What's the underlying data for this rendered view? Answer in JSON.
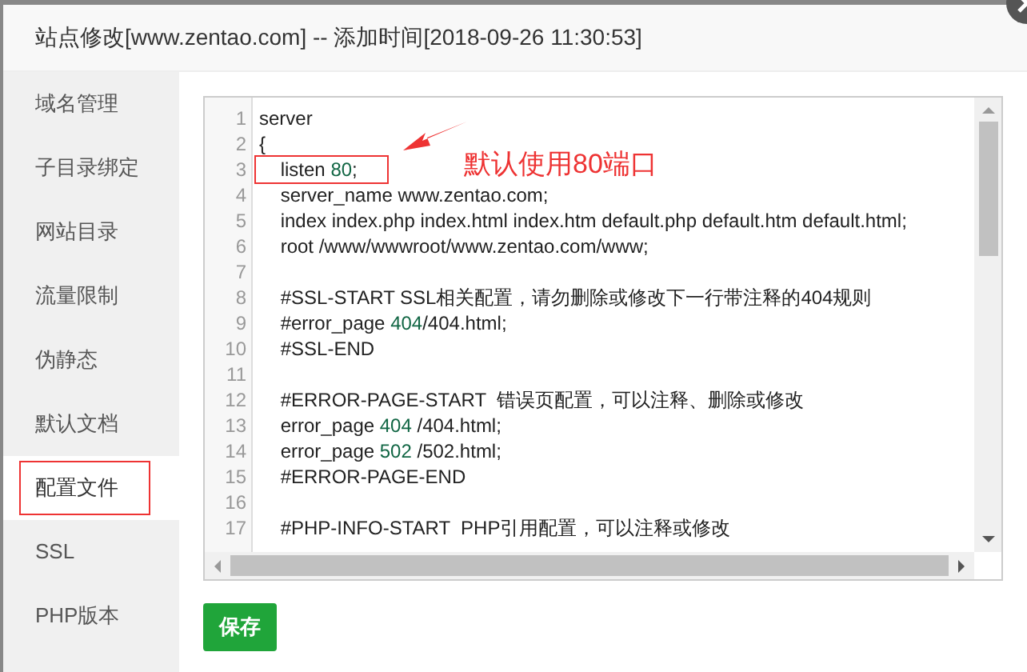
{
  "window": {
    "title": "站点修改[www.zentao.com] -- 添加时间[2018-09-26 11:30:53]"
  },
  "sidebar": {
    "items": [
      {
        "label": "域名管理",
        "selected": false
      },
      {
        "label": "子目录绑定",
        "selected": false
      },
      {
        "label": "网站目录",
        "selected": false
      },
      {
        "label": "流量限制",
        "selected": false
      },
      {
        "label": "伪静态",
        "selected": false
      },
      {
        "label": "默认文档",
        "selected": false
      },
      {
        "label": "配置文件",
        "selected": true
      },
      {
        "label": "SSL",
        "selected": false
      },
      {
        "label": "PHP版本",
        "selected": false
      }
    ]
  },
  "editor": {
    "lines": [
      {
        "number": "1",
        "boxed": false,
        "segments": [
          {
            "kind": "plain",
            "text": "server"
          }
        ]
      },
      {
        "number": "2",
        "boxed": false,
        "segments": [
          {
            "kind": "plain",
            "text": "{"
          }
        ]
      },
      {
        "number": "3",
        "boxed": true,
        "segments": [
          {
            "kind": "plain",
            "text": "    listen "
          },
          {
            "kind": "number",
            "text": "80"
          },
          {
            "kind": "plain",
            "text": ";"
          }
        ]
      },
      {
        "number": "4",
        "boxed": false,
        "segments": [
          {
            "kind": "plain",
            "text": "    server_name www.zentao.com;"
          }
        ]
      },
      {
        "number": "5",
        "boxed": false,
        "segments": [
          {
            "kind": "plain",
            "text": "    index index.php index.html index.htm default.php default.htm default.html;"
          }
        ]
      },
      {
        "number": "6",
        "boxed": false,
        "segments": [
          {
            "kind": "plain",
            "text": "    root /www/wwwroot/www.zentao.com/www;"
          }
        ]
      },
      {
        "number": "7",
        "boxed": false
      },
      {
        "number": "8",
        "boxed": false,
        "segments": [
          {
            "kind": "plain",
            "text": "    #SSL-START SSL相关配置，请勿删除或修改下一行带注释的404规则"
          }
        ]
      },
      {
        "number": "9",
        "boxed": false,
        "segments": [
          {
            "kind": "plain",
            "text": "    #error_page "
          },
          {
            "kind": "number",
            "text": "404"
          },
          {
            "kind": "plain",
            "text": "/404.html;"
          }
        ]
      },
      {
        "number": "10",
        "boxed": false,
        "segments": [
          {
            "kind": "plain",
            "text": "    #SSL-END"
          }
        ]
      },
      {
        "number": "11",
        "boxed": false
      },
      {
        "number": "12",
        "boxed": false,
        "segments": [
          {
            "kind": "plain",
            "text": "    #ERROR-PAGE-START  错误页配置，可以注释、删除或修改"
          }
        ]
      },
      {
        "number": "13",
        "boxed": false,
        "segments": [
          {
            "kind": "plain",
            "text": "    error_page "
          },
          {
            "kind": "number",
            "text": "404"
          },
          {
            "kind": "plain",
            "text": " /404.html;"
          }
        ]
      },
      {
        "number": "14",
        "boxed": false,
        "segments": [
          {
            "kind": "plain",
            "text": "    error_page "
          },
          {
            "kind": "number",
            "text": "502"
          },
          {
            "kind": "plain",
            "text": " /502.html;"
          }
        ]
      },
      {
        "number": "15",
        "boxed": false,
        "segments": [
          {
            "kind": "plain",
            "text": "    #ERROR-PAGE-END"
          }
        ]
      },
      {
        "number": "16",
        "boxed": false
      },
      {
        "number": "17",
        "boxed": false,
        "segments": [
          {
            "kind": "plain",
            "text": "    #PHP-INFO-START  PHP引用配置，可以注释或修改"
          }
        ]
      }
    ]
  },
  "annotation": {
    "text": "默认使用80端口"
  },
  "save_button": {
    "label": "保存"
  }
}
